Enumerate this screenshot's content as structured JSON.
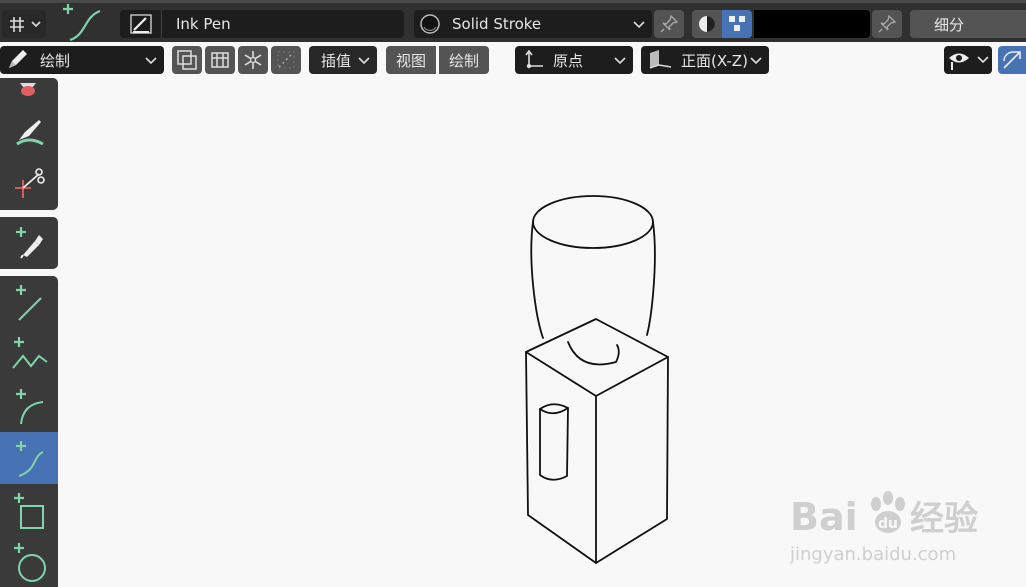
{
  "header": {
    "brush_name": "Ink Pen",
    "stroke_material": "Solid Stroke",
    "subdivide_label": "细分"
  },
  "toolbar": {
    "mode_label": "绘制",
    "interpolate_label": "插值",
    "view_label": "视图",
    "draw_label": "绘制",
    "origin_label": "原点",
    "plane_label": "正面(X-Z)"
  },
  "colors": {
    "header_bg": "#303030",
    "field_bg": "#1d1d1d",
    "active_tool": "#4772b3",
    "accent_green": "#7fd4a8",
    "canvas": "#f8f8f8"
  },
  "sidebar": {
    "tools": [
      {
        "name": "eraser",
        "icon": "eraser-icon"
      },
      {
        "name": "tint",
        "icon": "tint-brush-icon"
      },
      {
        "name": "cutter",
        "icon": "cutter-icon"
      },
      {
        "name": "eyedropper",
        "icon": "eyedropper-icon"
      },
      {
        "name": "line",
        "icon": "line-icon"
      },
      {
        "name": "polyline",
        "icon": "polyline-icon"
      },
      {
        "name": "arc",
        "icon": "arc-icon"
      },
      {
        "name": "curve",
        "icon": "curve-icon",
        "active": true
      },
      {
        "name": "box",
        "icon": "box-icon"
      },
      {
        "name": "circle",
        "icon": "circle-icon"
      }
    ]
  },
  "watermark": {
    "brand_a": "Bai",
    "brand_b": "du",
    "brand_cn": "经验",
    "url": "jingyan.baidu.com"
  }
}
